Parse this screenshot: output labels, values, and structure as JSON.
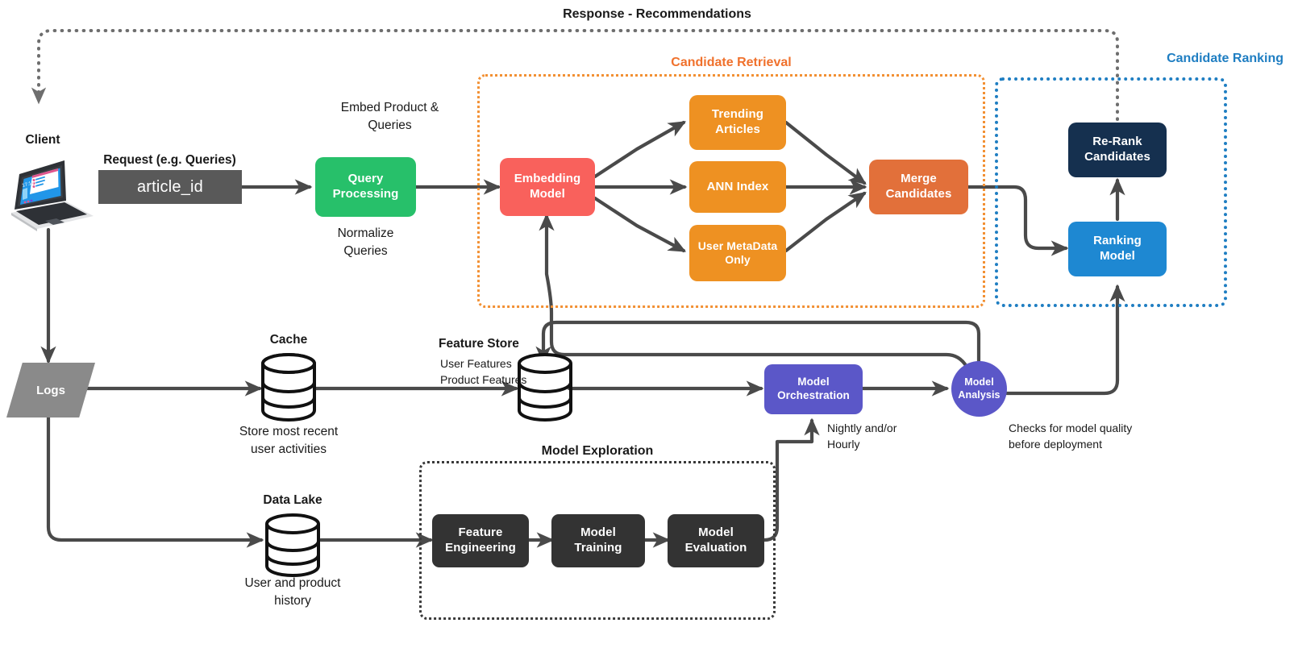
{
  "diagram": {
    "title": "Response - Recommendations",
    "groups": {
      "candidate_retrieval": {
        "title": "Candidate Retrieval",
        "color": "#F0712C"
      },
      "candidate_ranking": {
        "title": "Candidate Ranking",
        "color": "#1F7EC2"
      },
      "model_exploration": {
        "title": "Model Exploration",
        "color": "#1a1a1a"
      }
    },
    "nodes": {
      "client": {
        "label": "Client"
      },
      "request_title": {
        "label": "Request (e.g. Queries)"
      },
      "request_value": {
        "label": "article_id"
      },
      "query_processing": {
        "label": "Query\nProcessing",
        "line1": "Query",
        "line2": "Processing",
        "color": "#27C06A"
      },
      "embed_note": {
        "line1": "Embed Product &",
        "line2": "Queries"
      },
      "normalize_note": {
        "line1": "Normalize",
        "line2": "Queries"
      },
      "embedding_model": {
        "line1": "Embedding",
        "line2": "Model",
        "color": "#F9615C"
      },
      "trending_articles": {
        "line1": "Trending",
        "line2": "Articles",
        "color": "#EE9122"
      },
      "ann_index": {
        "line1": "ANN Index",
        "line2": "",
        "color": "#EE9122"
      },
      "user_metadata": {
        "line1": "User MetaData",
        "line2": "Only",
        "color": "#EE9122"
      },
      "merge_candidates": {
        "line1": "Merge",
        "line2": "Candidates",
        "color": "#E2703A"
      },
      "rerank_candidates": {
        "line1": "Re-Rank",
        "line2": "Candidates",
        "color": "#15304F"
      },
      "ranking_model": {
        "line1": "Ranking",
        "line2": "Model",
        "color": "#1E88D2"
      },
      "logs": {
        "label": "Logs",
        "color": "#8A8A8A"
      },
      "cache": {
        "title": "Cache",
        "note1": "Store most recent",
        "note2": "user activities"
      },
      "feature_store": {
        "title": "Feature Store",
        "sub1": "User Features",
        "sub2": "Product Features"
      },
      "data_lake": {
        "title": "Data Lake",
        "note1": "User and product",
        "note2": "history"
      },
      "model_orchestration": {
        "line1": "Model",
        "line2": "Orchestration",
        "color": "#5B57C8",
        "note1": "Nightly and/or",
        "note2": "Hourly"
      },
      "model_analysis": {
        "line1": "Model",
        "line2": "Analysis",
        "color": "#5B57C8",
        "note1": "Checks for model quality",
        "note2": "before deployment"
      },
      "feature_engineering": {
        "line1": "Feature",
        "line2": "Engineering",
        "color": "#333333"
      },
      "model_training": {
        "line1": "Model",
        "line2": "Training",
        "color": "#333333"
      },
      "model_evaluation": {
        "line1": "Model",
        "line2": "Evaluation",
        "color": "#333333"
      }
    },
    "colors": {
      "edge": "#4A4A4A",
      "response_dotted": "#6E6E6E",
      "retrieval_frame": "#F29033",
      "ranking_frame": "#1F7EC2",
      "explore_frame": "#3A3A3A"
    }
  }
}
